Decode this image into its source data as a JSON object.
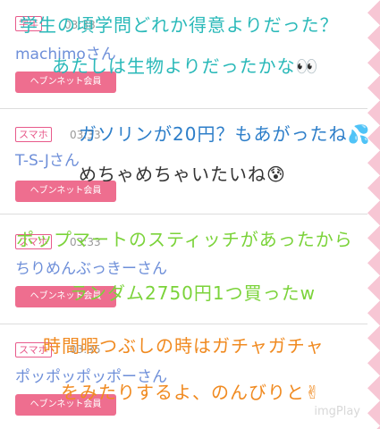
{
  "posts": [
    {
      "device": "学年",
      "time": "03:38",
      "username": "machimoさん",
      "member_label": "ヘブンネット会員",
      "comment_1": "学生の頃学問どれか得意よりだった？",
      "comment_2": "あたしは生物よりだったかな👀"
    },
    {
      "device": "スマホ",
      "time": "03:33",
      "username": "T-S-Jさん",
      "member_label": "ヘブンネット会員",
      "comment_1": "ガソリンが20円？もあがったね💦",
      "comment_2": "めちゃめちゃいたいね😰"
    },
    {
      "device": "スマホ",
      "time": "03:33",
      "username": "ちりめんぶっきーさん",
      "member_label": "ヘブンネット会員",
      "comment_1": "ポップマートのスティッチがあったから",
      "comment_2": "ランダム2750円1つ買ったw"
    },
    {
      "device": "スマホ",
      "time": "03:35",
      "username": "ポッポッポッポーさん",
      "member_label": "ヘブンネット会員",
      "comment_1": "時間暇つぶしの時はガチャガチャ",
      "comment_2": "をみたりするよ、のんびりと✌"
    }
  ],
  "watermark": "imgPlay",
  "colors": {
    "accent_pink": "#ee6e8f",
    "username_blue": "#6e8fd9",
    "teal": "#2ab9b9",
    "green": "#7bd33a",
    "orange": "#f08a20"
  }
}
